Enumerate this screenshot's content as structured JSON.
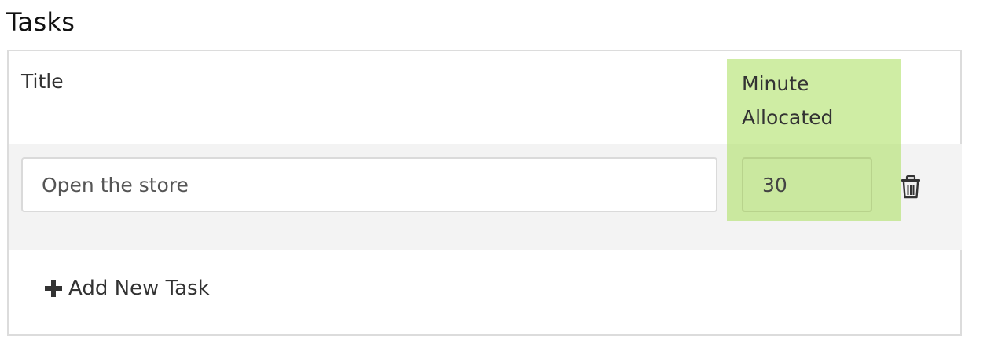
{
  "section": {
    "title": "Tasks"
  },
  "table": {
    "columns": {
      "title_header": "Title",
      "minutes_header": "Minute Allocated"
    },
    "rows": [
      {
        "title_value": "Open the store",
        "minutes_value": "30",
        "delete_icon": "trash-icon"
      }
    ],
    "add_button_label": "Add New Task",
    "add_icon": "plus-icon"
  },
  "colors": {
    "highlight": "#a8de5a",
    "row_background": "#f3f3f3",
    "border": "#dcdcdc"
  }
}
